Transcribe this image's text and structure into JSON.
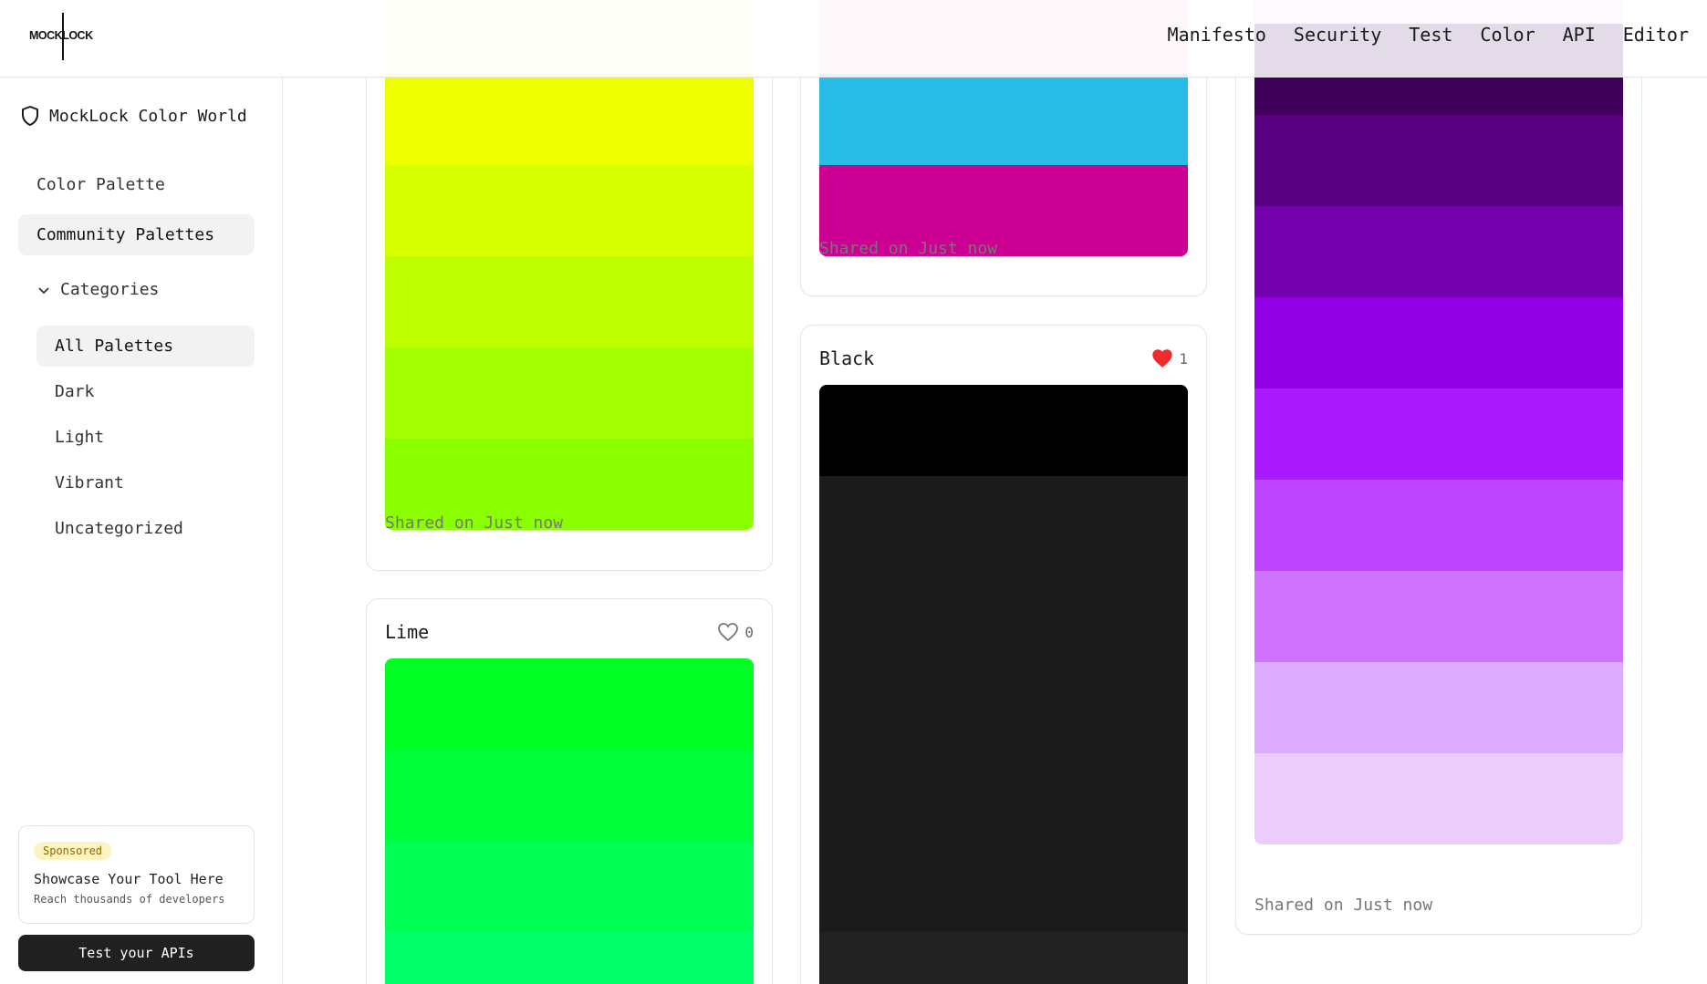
{
  "header": {
    "logo_text": "MOCKLOCK",
    "nav": [
      "Manifesto",
      "Security",
      "Test",
      "Color",
      "API",
      "Editor"
    ]
  },
  "sidebar": {
    "brand": "MockLock Color World",
    "brand_icon": "shield-icon",
    "items": [
      {
        "label": "Color Palette",
        "active": false
      },
      {
        "label": "Community Palettes",
        "active": true
      }
    ],
    "categories_label": "Categories",
    "categories": [
      {
        "label": "All Palettes",
        "active": true
      },
      {
        "label": "Dark",
        "active": false
      },
      {
        "label": "Light",
        "active": false
      },
      {
        "label": "Vibrant",
        "active": false
      },
      {
        "label": "Uncategorized",
        "active": false
      }
    ],
    "sponsor": {
      "badge": "Sponsored",
      "title": "Showcase Your Tool Here",
      "subtitle": "Reach thousands of developers"
    },
    "cta": "Test your APIs"
  },
  "cards": {
    "yellow": {
      "shared": "Shared on Just now",
      "colors": [
        "#fdfbd0",
        "#eeff00",
        "#d6ff00",
        "#bdff00",
        "#a4ff00",
        "#8aff00"
      ]
    },
    "lime": {
      "title": "Lime",
      "likes": "0",
      "liked": false,
      "colors": [
        "#00ff22",
        "#00ff3a",
        "#00ff52",
        "#00ff6a"
      ]
    },
    "blue_pink": {
      "shared": "Shared on Just now",
      "colors": [
        "#f8cfe4",
        "#29bce6",
        "#cc0092"
      ]
    },
    "black": {
      "title": "Black",
      "likes": "1",
      "liked": true,
      "colors": [
        "#000000",
        "#1b1b1b",
        "#1b1b1b",
        "#1b1b1b",
        "#1b1b1b",
        "#1b1b1b",
        "#222222"
      ]
    },
    "purple": {
      "shared": "Shared on Just now",
      "colors": [
        "#ecd0fb",
        "#3e0059",
        "#56007f",
        "#7200ad",
        "#9200e6",
        "#a91aff",
        "#be45ff",
        "#cf73ff",
        "#ddabff",
        "#ebcdfb"
      ]
    }
  }
}
